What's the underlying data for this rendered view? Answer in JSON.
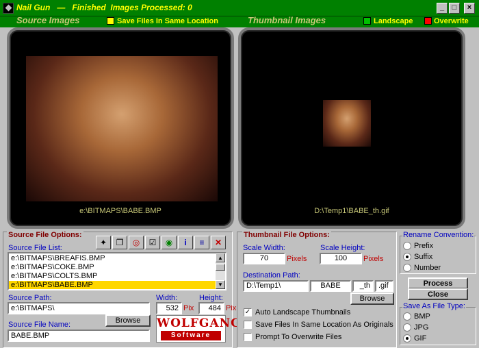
{
  "titlebar": {
    "app_name": "Nail Gun",
    "separator": "—",
    "status": "Finished  Images Processed: 0",
    "min": "_",
    "max": "□",
    "close": "×"
  },
  "viewers": {
    "source_label": "Source Images",
    "same_location_label": "Save Files In Same Location",
    "thumb_label": "Thumbnail Images",
    "landscape_label": "Landscape",
    "overwrite_label": "Overwrite",
    "source_caption": "e:\\BITMAPS\\BABE.BMP",
    "thumb_caption": "D:\\Temp1\\BABE_th.gif",
    "colors": {
      "same_location": "#ffff00",
      "landscape": "#00c000",
      "overwrite": "#ff0000"
    }
  },
  "source": {
    "group_title": "Source File Options:",
    "list_label": "Source File List:",
    "files": [
      "e:\\BITMAPS\\BREAFIS.BMP",
      "e:\\BITMAPS\\COKE.BMP",
      "e:\\BITMAPS\\COLTS.BMP",
      "e:\\BITMAPS\\BABE.BMP"
    ],
    "selected_index": 3,
    "path_label": "Source Path:",
    "path_value": "e:\\BITMAPS\\",
    "width_label": "Width:",
    "width_value": "532",
    "height_label": "Height:",
    "height_value": "484",
    "pix_label": "Pix",
    "browse_label": "Browse",
    "filename_label": "Source File Name:",
    "filename_value": "BABE.BMP",
    "logo_top": "WOLFGANG",
    "logo_bottom": "Software",
    "toolbar_icons": [
      "wand-icon",
      "copy-icon",
      "target-icon",
      "select-icon",
      "globe-icon",
      "info-icon",
      "list-icon",
      "delete-icon"
    ]
  },
  "thumbnail": {
    "group_title": "Thumbnail File Options:",
    "scale_width_label": "Scale Width:",
    "scale_width_value": "70",
    "scale_height_label": "Scale Height:",
    "scale_height_value": "100",
    "pixels_label": "Pixels",
    "dest_label": "Destination Path:",
    "dest_path": "D:\\Temp1\\",
    "dest_name": "BABE",
    "dest_suffix": "_th",
    "dest_ext": ".gif",
    "browse_label": "Browse",
    "checks": [
      {
        "label": "Auto Landscape Thumbnails",
        "checked": true
      },
      {
        "label": "Save Files In Same Location As Originals",
        "checked": false
      },
      {
        "label": "Prompt To Overwrite Files",
        "checked": false
      }
    ]
  },
  "rename": {
    "title": "Rename Convention:",
    "options": [
      "Prefix",
      "Suffix",
      "Number"
    ],
    "selected": "Suffix"
  },
  "actions": {
    "process": "Process",
    "close": "Close"
  },
  "filetype": {
    "title": "Save As File Type:",
    "options": [
      "BMP",
      "JPG",
      "GIF"
    ],
    "selected": "GIF"
  }
}
